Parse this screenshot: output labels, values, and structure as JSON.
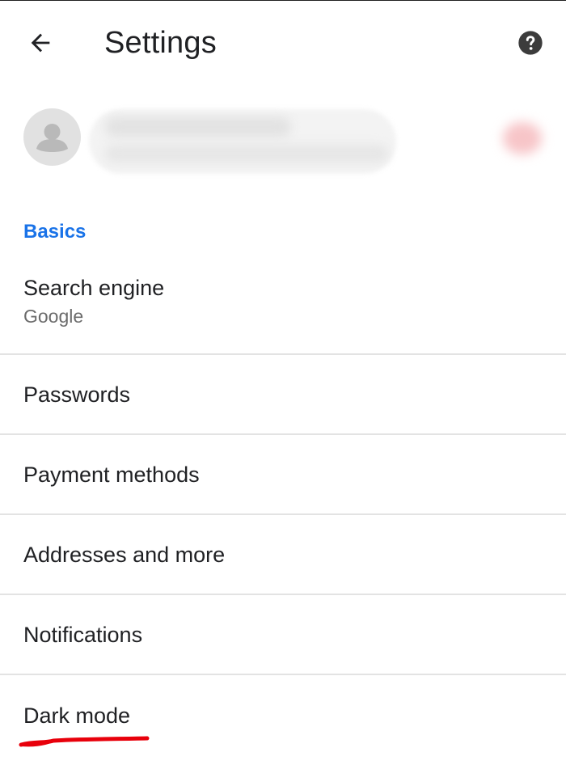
{
  "header": {
    "title": "Settings",
    "back_icon": "arrow-back-icon",
    "help_icon": "help-icon"
  },
  "account": {
    "avatar_icon": "person-avatar-icon",
    "sync_icon": "sync-error-icon"
  },
  "section": {
    "title": "Basics"
  },
  "items": [
    {
      "title": "Search engine",
      "subtitle": "Google"
    },
    {
      "title": "Passwords"
    },
    {
      "title": "Payment methods"
    },
    {
      "title": "Addresses and more"
    },
    {
      "title": "Notifications"
    },
    {
      "title": "Dark mode"
    }
  ],
  "colors": {
    "accent": "#1a73e8",
    "annotation": "#e8000b",
    "divider": "#e3e3e3"
  }
}
